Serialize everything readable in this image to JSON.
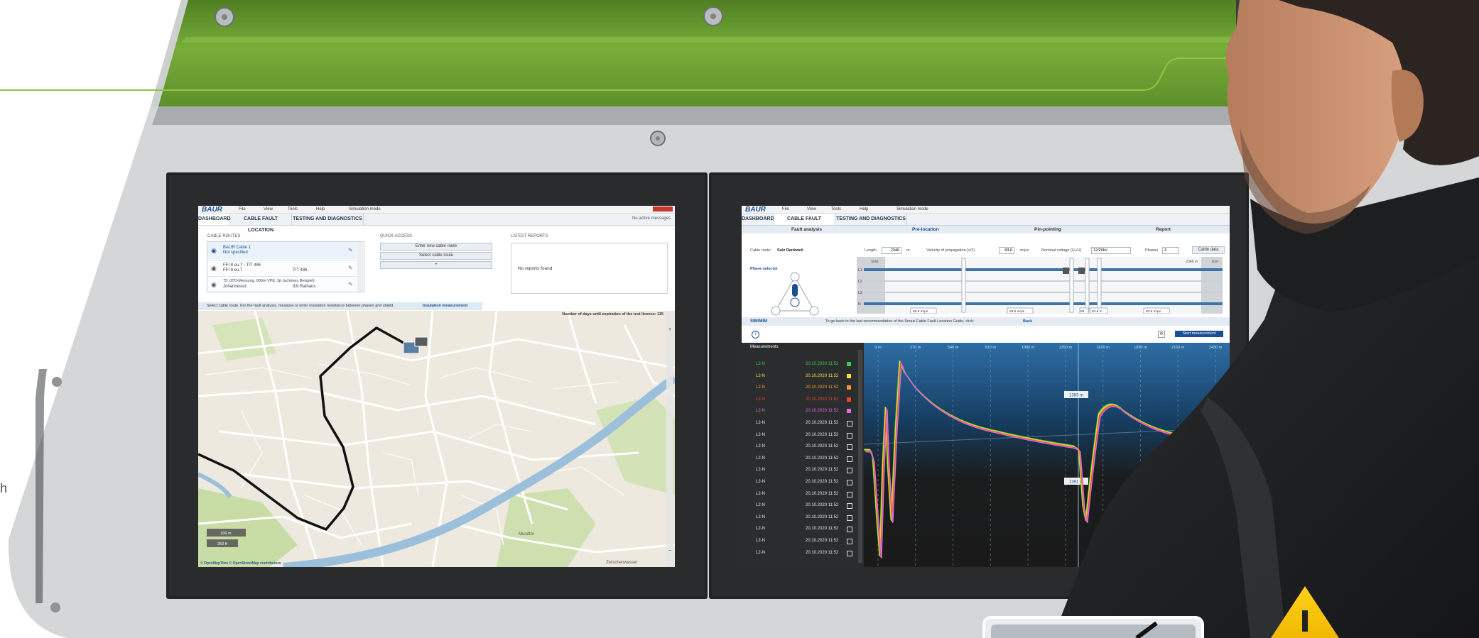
{
  "colors": {
    "machine_green": "#77ab37",
    "accent_line": "#8dc63f",
    "brand_blue": "#1b4f93",
    "plot_background": "#1a1a1a",
    "warning_yellow": "#f5c400"
  },
  "left_screen": {
    "app": {
      "logo": "BAUR",
      "menu": [
        "File",
        "View",
        "Tools",
        "Help"
      ],
      "mode": "Simulation mode"
    },
    "tabs": [
      "DASHBOARD",
      "CABLE FAULT LOCATION",
      "TESTING AND DIAGNOSTICS"
    ],
    "messages": "No active messages",
    "cable_routes": {
      "heading": "CABLE ROUTES",
      "items": [
        {
          "title": "BAUR Cable 1",
          "subtitle": "Not specified",
          "right": ""
        },
        {
          "title": "FFI 8 eu.7 - TIT 486",
          "subtitle": "FFI 8 eu.7",
          "right": "TIT 486"
        },
        {
          "title": "75 (JTD-Messung, 900m VPE, 3p (schönes Beispiel)",
          "subtitle": "Johannesstr.",
          "right": "33I Rathaus"
        }
      ]
    },
    "quick_access": {
      "heading": "QUICK ACCESS",
      "buttons": [
        "Enter new cable route",
        "Select cable route",
        "+"
      ]
    },
    "latest_reports": {
      "heading": "LATEST REPORTS",
      "empty_text": "No reports found"
    },
    "instruction": "Select cable route. For the fault analysis, measure or enter insulation resistance between phases and shield.",
    "instruction_link": "Insulation measurement",
    "license_notice": "Number of days until expiration of the test license: 115",
    "map": {
      "scale_100": "100 m",
      "scale_250": "250 ft",
      "attribution": "© OpenMapTiles © OpenStreetMap contributors",
      "place_labels": [
        "Mundtor",
        "Zwischenwasser"
      ]
    }
  },
  "right_screen": {
    "app": {
      "logo": "BAUR",
      "menu": [
        "File",
        "View",
        "Tools",
        "Help"
      ],
      "mode": "Simulation mode"
    },
    "tabs": [
      "DASHBOARD",
      "CABLE FAULT LOCATION",
      "TESTING AND DIAGNOSTICS"
    ],
    "steps": [
      "Fault analysis",
      "Pre-location",
      "Pin-pointing",
      "Report"
    ],
    "cable_route_label": "Cable route:",
    "cable_route_value": "Sulz Rankweil",
    "length_label": "Length",
    "length_value": "2346",
    "length_unit": "m",
    "vop_label": "Velocity of propagation (v/2)",
    "vop_value": "83.6",
    "vop_unit": "m/µs",
    "voltage_label": "Nominal voltage (U₀/U)",
    "voltage_value": "12/20kV",
    "phases_label": "Phases",
    "phases_value": "3",
    "cable_data_button": "Cable data",
    "phase_selector_label": "Phase selector",
    "phase_rows": [
      "L1",
      "L2",
      "L3",
      "N"
    ],
    "route_start": "Start",
    "route_end_value": "2346 m",
    "route_end_label": "End",
    "vop_markers": [
      "83.6 m/µs",
      "83.6 m/µs",
      "83.",
      "83.6 m",
      "83.6 m/µs"
    ],
    "method": "SIM/MIM",
    "guide_text": "To go back to the last recommendation of the Smart Cable Fault Location Guide, click:",
    "guide_link": "Back",
    "start_button": "Start measurement",
    "measurements_heading": "Measurements",
    "measurements": [
      {
        "phase": "L2-N",
        "time": "20.10.2020 11:52",
        "color": "#35d04a",
        "checked": true
      },
      {
        "phase": "L2-N",
        "time": "20.10.2020 11:52",
        "color": "#f3e03a",
        "checked": true
      },
      {
        "phase": "L2-N",
        "time": "20.10.2020 11:52",
        "color": "#f29a2e",
        "checked": true
      },
      {
        "phase": "L2-N",
        "time": "20.10.2020 11:52",
        "color": "#e8472b",
        "checked": true
      },
      {
        "phase": "L2-N",
        "time": "20.10.2020 11:52",
        "color": "#d86ee6",
        "checked": true
      },
      {
        "phase": "L2-N",
        "time": "20.10.2020 11:52",
        "color": "",
        "checked": false
      },
      {
        "phase": "L2-N",
        "time": "20.10.2020 11:52",
        "color": "",
        "checked": false
      },
      {
        "phase": "L2-N",
        "time": "20.10.2020 11:52",
        "color": "",
        "checked": false
      },
      {
        "phase": "L2-N",
        "time": "20.10.2020 11:52",
        "color": "",
        "checked": false
      },
      {
        "phase": "L2-N",
        "time": "20.10.2020 11:52",
        "color": "",
        "checked": false
      },
      {
        "phase": "L2-N",
        "time": "20.10.2020 11:52",
        "color": "",
        "checked": false
      },
      {
        "phase": "L2-N",
        "time": "20.10.2020 11:52",
        "color": "",
        "checked": false
      },
      {
        "phase": "L2-N",
        "time": "20.10.2020 11:52",
        "color": "",
        "checked": false
      },
      {
        "phase": "L2-N",
        "time": "20.10.2020 11:52",
        "color": "",
        "checked": false
      },
      {
        "phase": "L2-N",
        "time": "20.10.2020 11:52",
        "color": "",
        "checked": false
      },
      {
        "phase": "L2-N",
        "time": "20.10.2020 11:52",
        "color": "",
        "checked": false
      },
      {
        "phase": "L2-N",
        "time": "20.10.2020 11:52",
        "color": "",
        "checked": false
      }
    ],
    "plot_axis_ticks": [
      "0 m",
      "270 m",
      "540 m",
      "810 m",
      "1080 m",
      "1350 m",
      "1620 m",
      "1890 m",
      "2160 m",
      "2430 m"
    ],
    "cursor_labels": [
      "1383 m",
      "1391 m"
    ]
  },
  "edge_fragment": "h"
}
